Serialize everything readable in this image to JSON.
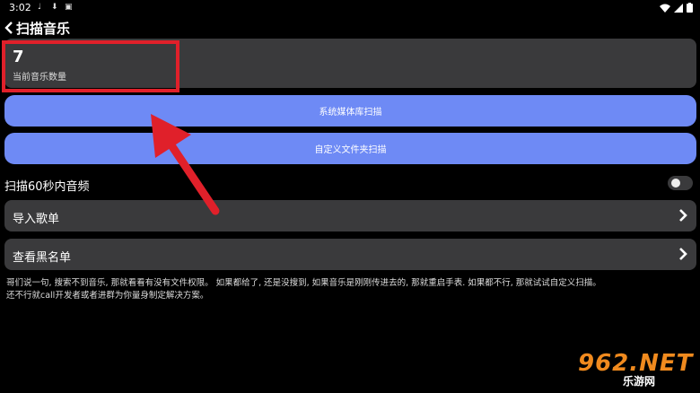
{
  "status_bar": {
    "time": "3:02"
  },
  "header": {
    "title": "扫描音乐"
  },
  "count_card": {
    "value": "7",
    "label": "当前音乐数量"
  },
  "buttons": {
    "system_scan": "系统媒体库扫描",
    "custom_scan": "自定义文件夹扫描"
  },
  "toggle": {
    "label": "扫描60秒内音频",
    "enabled": false
  },
  "list": {
    "import_playlist": "导入歌单",
    "view_blacklist": "查看黑名单"
  },
  "note": {
    "line1": "哥们说一句, 搜索不到音乐, 那就看看有没有文件权限。 如果都给了, 还是没搜到, 如果音乐是刚刚传进去的, 那就重启手表. 如果都不行, 那就试试自定义扫描。",
    "line2": "还不行就call开发者或者进群为你量身制定解决方案。"
  },
  "watermark": {
    "brand": "962.NET",
    "sub": "乐游网"
  },
  "colors": {
    "accent_button": "#6e8af5",
    "card": "#3a3a3c",
    "highlight": "#e0202a"
  }
}
